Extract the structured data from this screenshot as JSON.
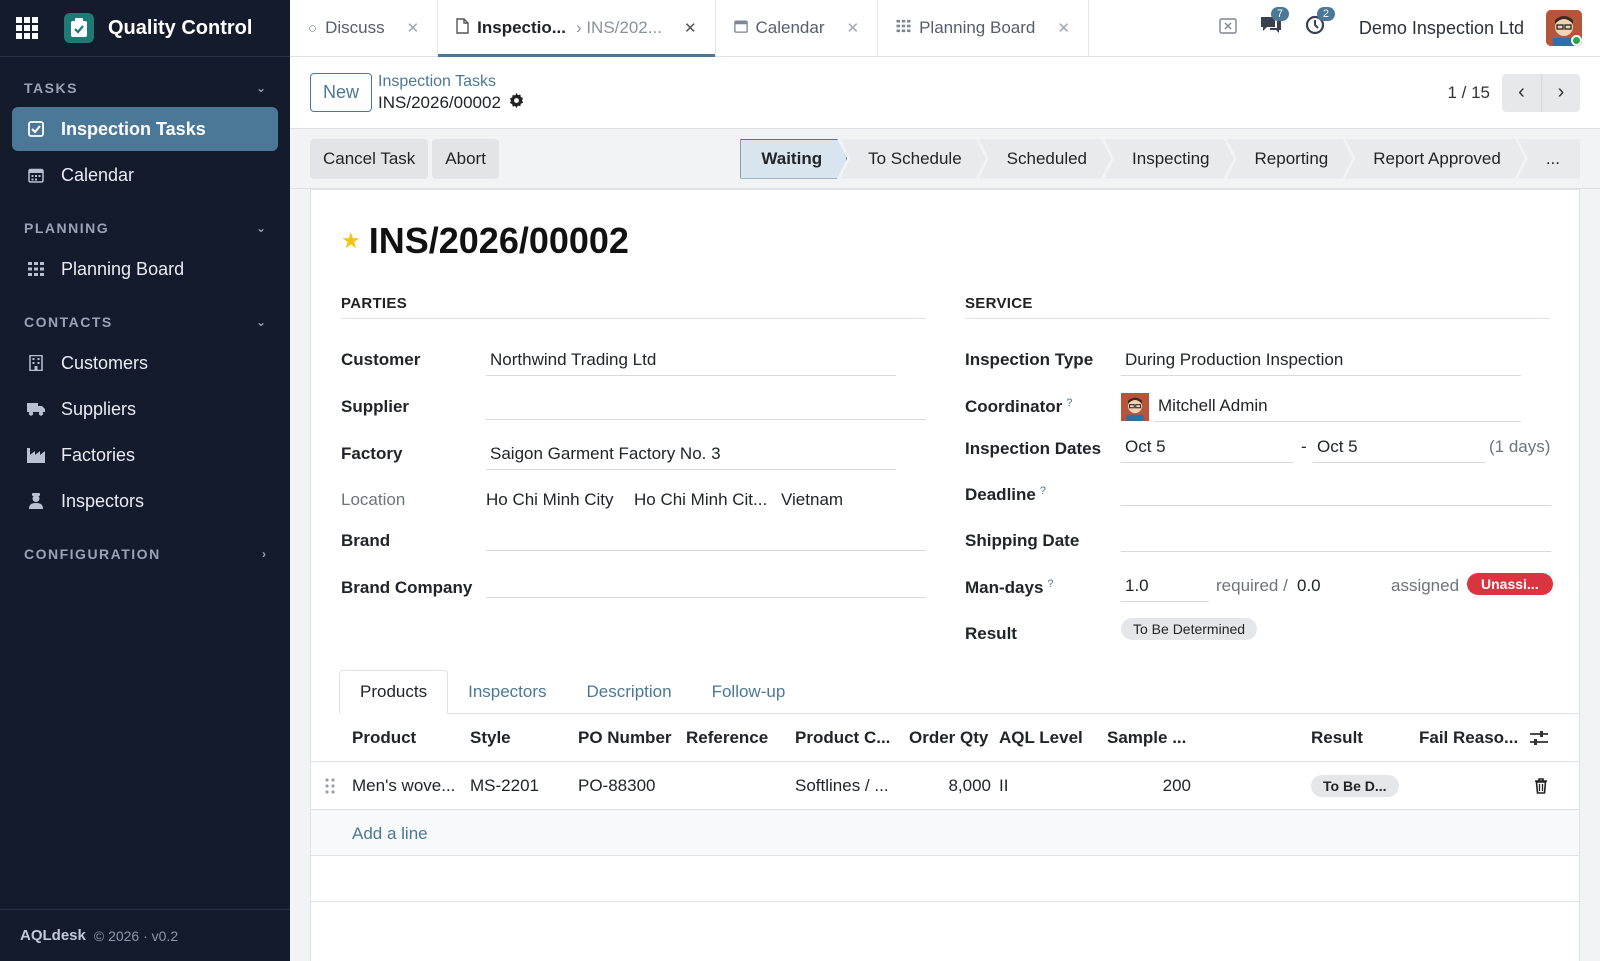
{
  "app": {
    "title": "Quality Control"
  },
  "sidebar": {
    "sections": [
      {
        "label": "TASKS",
        "items": [
          {
            "label": "Inspection Tasks",
            "icon": "checkbox-icon",
            "active": true
          },
          {
            "label": "Calendar",
            "icon": "calendar-icon",
            "active": false
          }
        ]
      },
      {
        "label": "PLANNING",
        "items": [
          {
            "label": "Planning Board",
            "icon": "grid-icon",
            "active": false
          }
        ]
      },
      {
        "label": "CONTACTS",
        "items": [
          {
            "label": "Customers",
            "icon": "building-icon",
            "active": false
          },
          {
            "label": "Suppliers",
            "icon": "truck-icon",
            "active": false
          },
          {
            "label": "Factories",
            "icon": "factory-icon",
            "active": false
          },
          {
            "label": "Inspectors",
            "icon": "user-icon",
            "active": false
          }
        ]
      },
      {
        "label": "CONFIGURATION",
        "items": []
      }
    ],
    "footer": {
      "brand": "AQLdesk",
      "meta": "© 2026 · v0.2"
    }
  },
  "tabs": [
    {
      "label": "Discuss",
      "icon": "circle-icon"
    },
    {
      "label": "Inspectio...",
      "sub": "› INS/202...",
      "icon": "document-icon",
      "active": true
    },
    {
      "label": "Calendar",
      "icon": "calendar-icon"
    },
    {
      "label": "Planning Board",
      "icon": "grid-icon"
    }
  ],
  "topbar": {
    "messages_count": "7",
    "activities_count": "2",
    "company": "Demo Inspection Ltd"
  },
  "control_panel": {
    "new_label": "New",
    "breadcrumb": "Inspection Tasks",
    "record_name": "INS/2026/00002",
    "pager": "1 / 15"
  },
  "statusbar": {
    "actions": [
      "Cancel Task",
      "Abort"
    ],
    "stages": [
      "Waiting",
      "To Schedule",
      "Scheduled",
      "Inspecting",
      "Reporting",
      "Report Approved",
      "..."
    ],
    "current_stage": "Waiting"
  },
  "form": {
    "title": "INS/2026/00002",
    "parties": {
      "heading": "PARTIES",
      "customer_label": "Customer",
      "customer": "Northwind Trading Ltd",
      "supplier_label": "Supplier",
      "supplier": "",
      "factory_label": "Factory",
      "factory": "Saigon Garment Factory No. 3",
      "location_label": "Location",
      "location_city": "Ho Chi Minh City",
      "location_state": "Ho Chi Minh Cit...",
      "location_country": "Vietnam",
      "brand_label": "Brand",
      "brand": "",
      "brand_company_label": "Brand Company",
      "brand_company": ""
    },
    "service": {
      "heading": "SERVICE",
      "inspection_type_label": "Inspection Type",
      "inspection_type": "During Production Inspection",
      "coordinator_label": "Coordinator",
      "coordinator": "Mitchell Admin",
      "dates_label": "Inspection Dates",
      "date_start": "Oct 5",
      "date_sep": "-",
      "date_end": "Oct 5",
      "date_days": "(1 days)",
      "deadline_label": "Deadline",
      "deadline": "",
      "shipping_label": "Shipping Date",
      "shipping": "",
      "mandays_label": "Man-days",
      "mandays_required": "1.0",
      "required_text": "required /",
      "mandays_assigned": "0.0",
      "assigned_text": "assigned",
      "assign_status": "Unassi...",
      "result_label": "Result",
      "result": "To Be Determined"
    },
    "help_mark": "?"
  },
  "notebook": {
    "tabs": [
      "Products",
      "Inspectors",
      "Description",
      "Follow-up"
    ],
    "active": "Products",
    "columns": [
      "Product",
      "Style",
      "PO Number",
      "Reference",
      "Product C...",
      "Order Qty",
      "AQL Level",
      "Sample ...",
      "Result",
      "Fail Reaso..."
    ],
    "rows": [
      {
        "product": "Men's wove...",
        "style": "MS-2201",
        "po": "PO-88300",
        "reference": "",
        "category": "Softlines / ...",
        "qty": "8,000",
        "aql": "II",
        "sample": "200",
        "result": "To Be D...",
        "fail": ""
      }
    ],
    "add_line": "Add a line"
  }
}
